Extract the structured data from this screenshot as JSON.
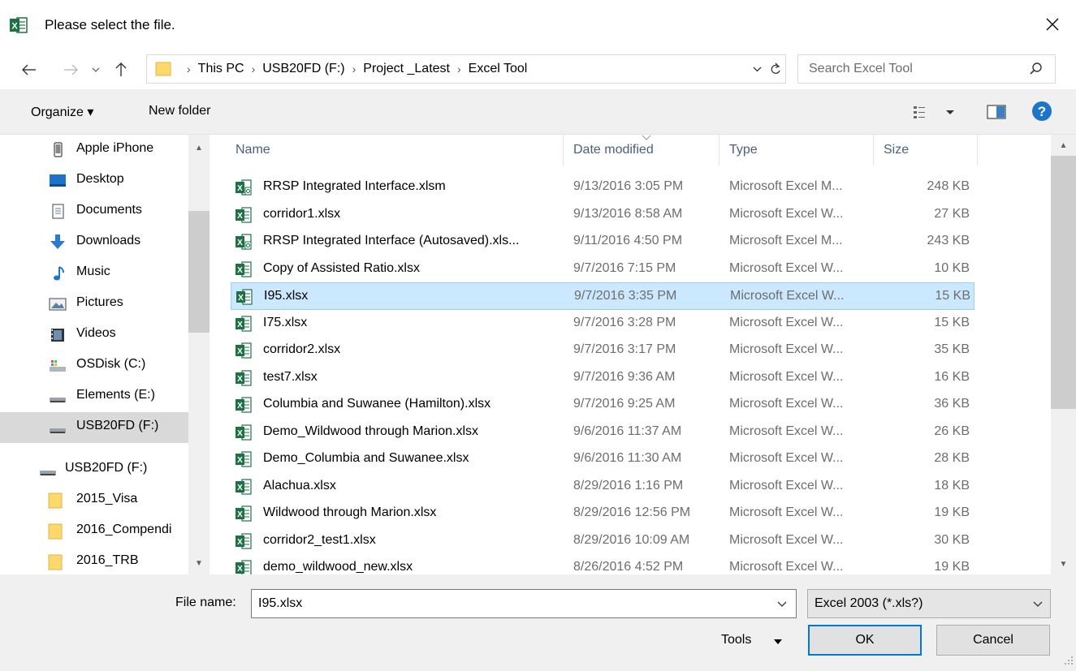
{
  "window": {
    "title": "Please select the file.",
    "colors": {
      "excel_green": "#1e7145",
      "selection": "#cce8ff",
      "accent": "#0078d7",
      "folder": "#ffd86b"
    }
  },
  "address": {
    "crumbs": [
      "This PC",
      "USB20FD (F:)",
      "Project _Latest",
      "Excel Tool"
    ],
    "separator": "›"
  },
  "search": {
    "placeholder": "Search Excel Tool"
  },
  "toolbar": {
    "organize_label": "Organize ▾",
    "new_folder_label": "New folder"
  },
  "nav": {
    "items": [
      {
        "label": "Apple iPhone",
        "icon": "phone-icon"
      },
      {
        "label": "Desktop",
        "icon": "desktop-icon"
      },
      {
        "label": "Documents",
        "icon": "documents-icon"
      },
      {
        "label": "Downloads",
        "icon": "downloads-icon"
      },
      {
        "label": "Music",
        "icon": "music-icon"
      },
      {
        "label": "Pictures",
        "icon": "pictures-icon"
      },
      {
        "label": "Videos",
        "icon": "videos-icon"
      },
      {
        "label": "OSDisk (C:)",
        "icon": "osdisk-icon"
      },
      {
        "label": "Elements (E:)",
        "icon": "drive-icon"
      },
      {
        "label": "USB20FD (F:)",
        "icon": "drive-icon",
        "selected": true
      },
      {
        "label": "USB20FD (F:)",
        "icon": "drive-icon"
      },
      {
        "label": "2015_Visa",
        "icon": "folder-icon"
      },
      {
        "label": "2016_Compendi",
        "icon": "folder-icon"
      },
      {
        "label": "2016_TRB",
        "icon": "folder-icon"
      }
    ]
  },
  "files": {
    "columns": [
      "Name",
      "Date modified",
      "Type",
      "Size"
    ],
    "rows": [
      {
        "name": "RRSP Integrated Interface.xlsm",
        "date": "9/13/2016 3:05 PM",
        "type": "Microsoft Excel M...",
        "size": "248 KB",
        "icon": "excel-macro-file-icon"
      },
      {
        "name": "corridor1.xlsx",
        "date": "9/13/2016 8:58 AM",
        "type": "Microsoft Excel W...",
        "size": "27 KB",
        "icon": "excel-file-icon"
      },
      {
        "name": "RRSP Integrated Interface (Autosaved).xls...",
        "date": "9/11/2016 4:50 PM",
        "type": "Microsoft Excel M...",
        "size": "243 KB",
        "icon": "excel-macro-file-icon"
      },
      {
        "name": "Copy of Assisted Ratio.xlsx",
        "date": "9/7/2016 7:15 PM",
        "type": "Microsoft Excel W...",
        "size": "10 KB",
        "icon": "excel-file-icon"
      },
      {
        "name": "I95.xlsx",
        "date": "9/7/2016 3:35 PM",
        "type": "Microsoft Excel W...",
        "size": "15 KB",
        "icon": "excel-file-icon",
        "selected": true
      },
      {
        "name": "I75.xlsx",
        "date": "9/7/2016 3:28 PM",
        "type": "Microsoft Excel W...",
        "size": "15 KB",
        "icon": "excel-file-icon"
      },
      {
        "name": "corridor2.xlsx",
        "date": "9/7/2016 3:17 PM",
        "type": "Microsoft Excel W...",
        "size": "35 KB",
        "icon": "excel-file-icon"
      },
      {
        "name": "test7.xlsx",
        "date": "9/7/2016 9:36 AM",
        "type": "Microsoft Excel W...",
        "size": "16 KB",
        "icon": "excel-file-icon"
      },
      {
        "name": "Columbia and Suwanee (Hamilton).xlsx",
        "date": "9/7/2016 9:25 AM",
        "type": "Microsoft Excel W...",
        "size": "36 KB",
        "icon": "excel-file-icon"
      },
      {
        "name": "Demo_Wildwood through Marion.xlsx",
        "date": "9/6/2016 11:37 AM",
        "type": "Microsoft Excel W...",
        "size": "26 KB",
        "icon": "excel-file-icon"
      },
      {
        "name": "Demo_Columbia and Suwanee.xlsx",
        "date": "9/6/2016 11:30 AM",
        "type": "Microsoft Excel W...",
        "size": "28 KB",
        "icon": "excel-file-icon"
      },
      {
        "name": "Alachua.xlsx",
        "date": "8/29/2016 1:16 PM",
        "type": "Microsoft Excel W...",
        "size": "18 KB",
        "icon": "excel-file-icon"
      },
      {
        "name": "Wildwood through Marion.xlsx",
        "date": "8/29/2016 12:56 PM",
        "type": "Microsoft Excel W...",
        "size": "19 KB",
        "icon": "excel-file-icon"
      },
      {
        "name": "corridor2_test1.xlsx",
        "date": "8/29/2016 10:09 AM",
        "type": "Microsoft Excel W...",
        "size": "30 KB",
        "icon": "excel-file-icon"
      },
      {
        "name": "demo_wildwood_new.xlsx",
        "date": "8/26/2016 4:52 PM",
        "type": "Microsoft Excel W...",
        "size": "19 KB",
        "icon": "excel-file-icon"
      }
    ]
  },
  "footer": {
    "file_name_label": "File name:",
    "file_name_value": "I95.xlsx",
    "file_type_value": "Excel 2003 (*.xls?)",
    "tools_label": "Tools",
    "ok_label": "OK",
    "cancel_label": "Cancel"
  }
}
